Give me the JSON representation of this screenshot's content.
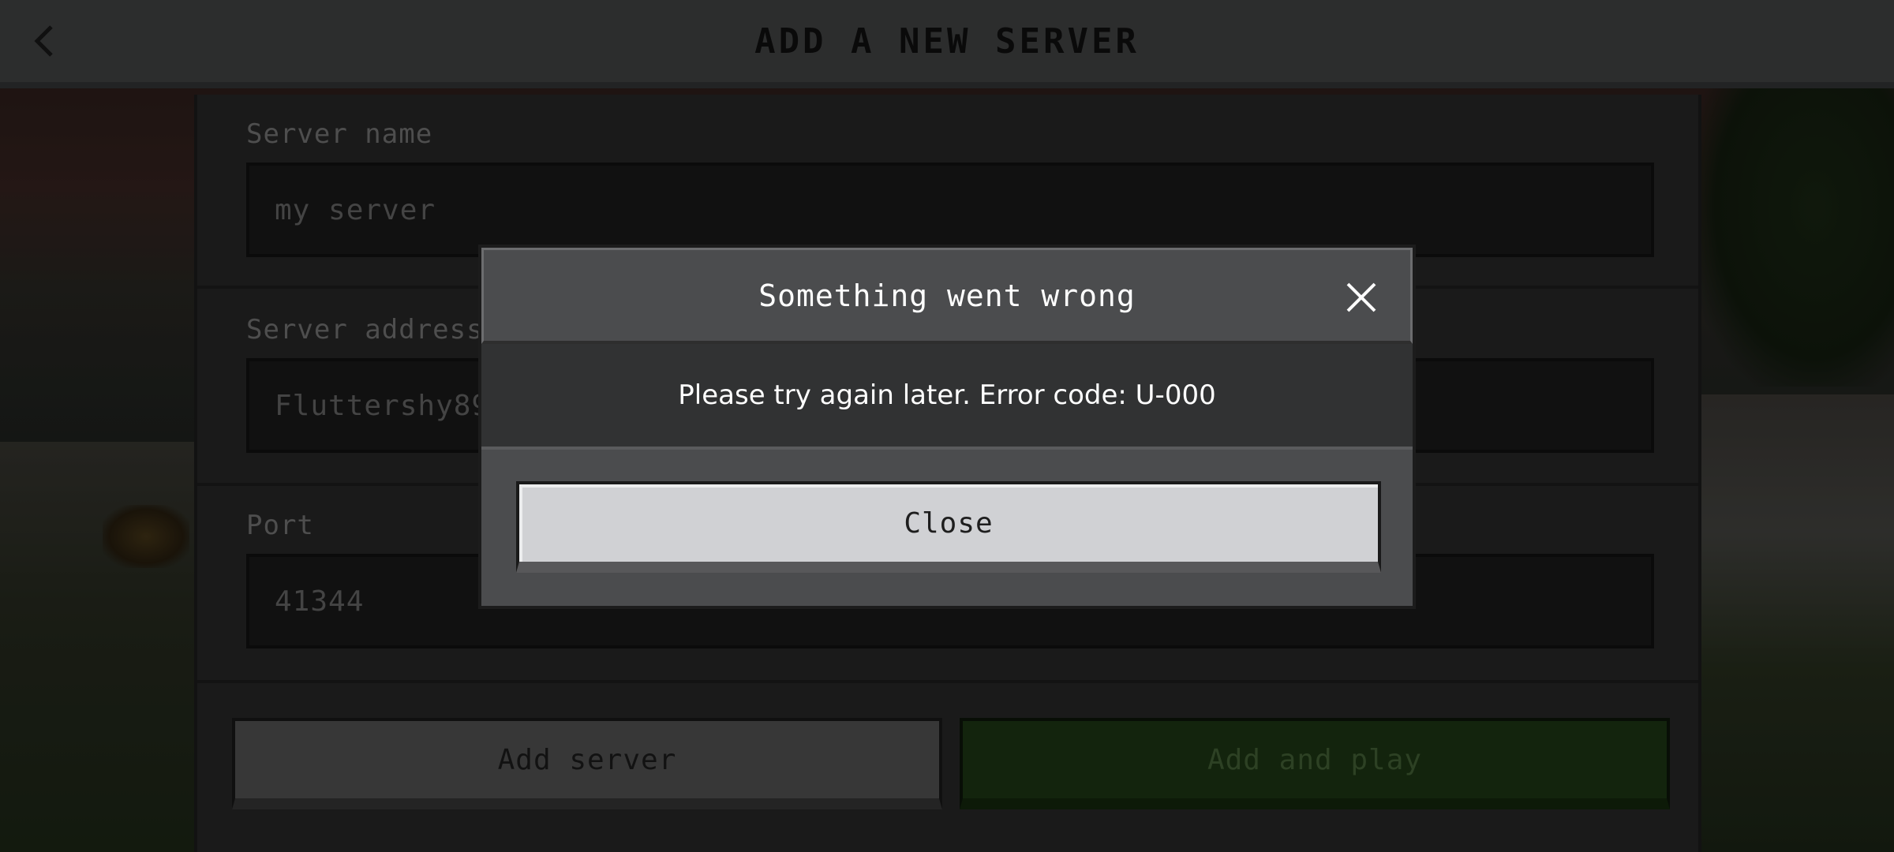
{
  "header": {
    "title": "ADD A NEW SERVER",
    "back_icon": "chevron-left-icon"
  },
  "form": {
    "server_name": {
      "label": "Server name",
      "value": "my server"
    },
    "server_address": {
      "label": "Server address",
      "value": "Fluttershy89"
    },
    "port": {
      "label": "Port",
      "value": "41344"
    },
    "add_server_label": "Add server",
    "add_and_play_label": "Add and play"
  },
  "dialog": {
    "title": "Something went wrong",
    "close_icon": "close-x-icon",
    "message": "Please try again later. Error code: U-000",
    "close_label": "Close"
  },
  "colors": {
    "header_bg": "#48494a",
    "play_button": "#1f3a15",
    "dialog_button": "#d0d1d4"
  }
}
